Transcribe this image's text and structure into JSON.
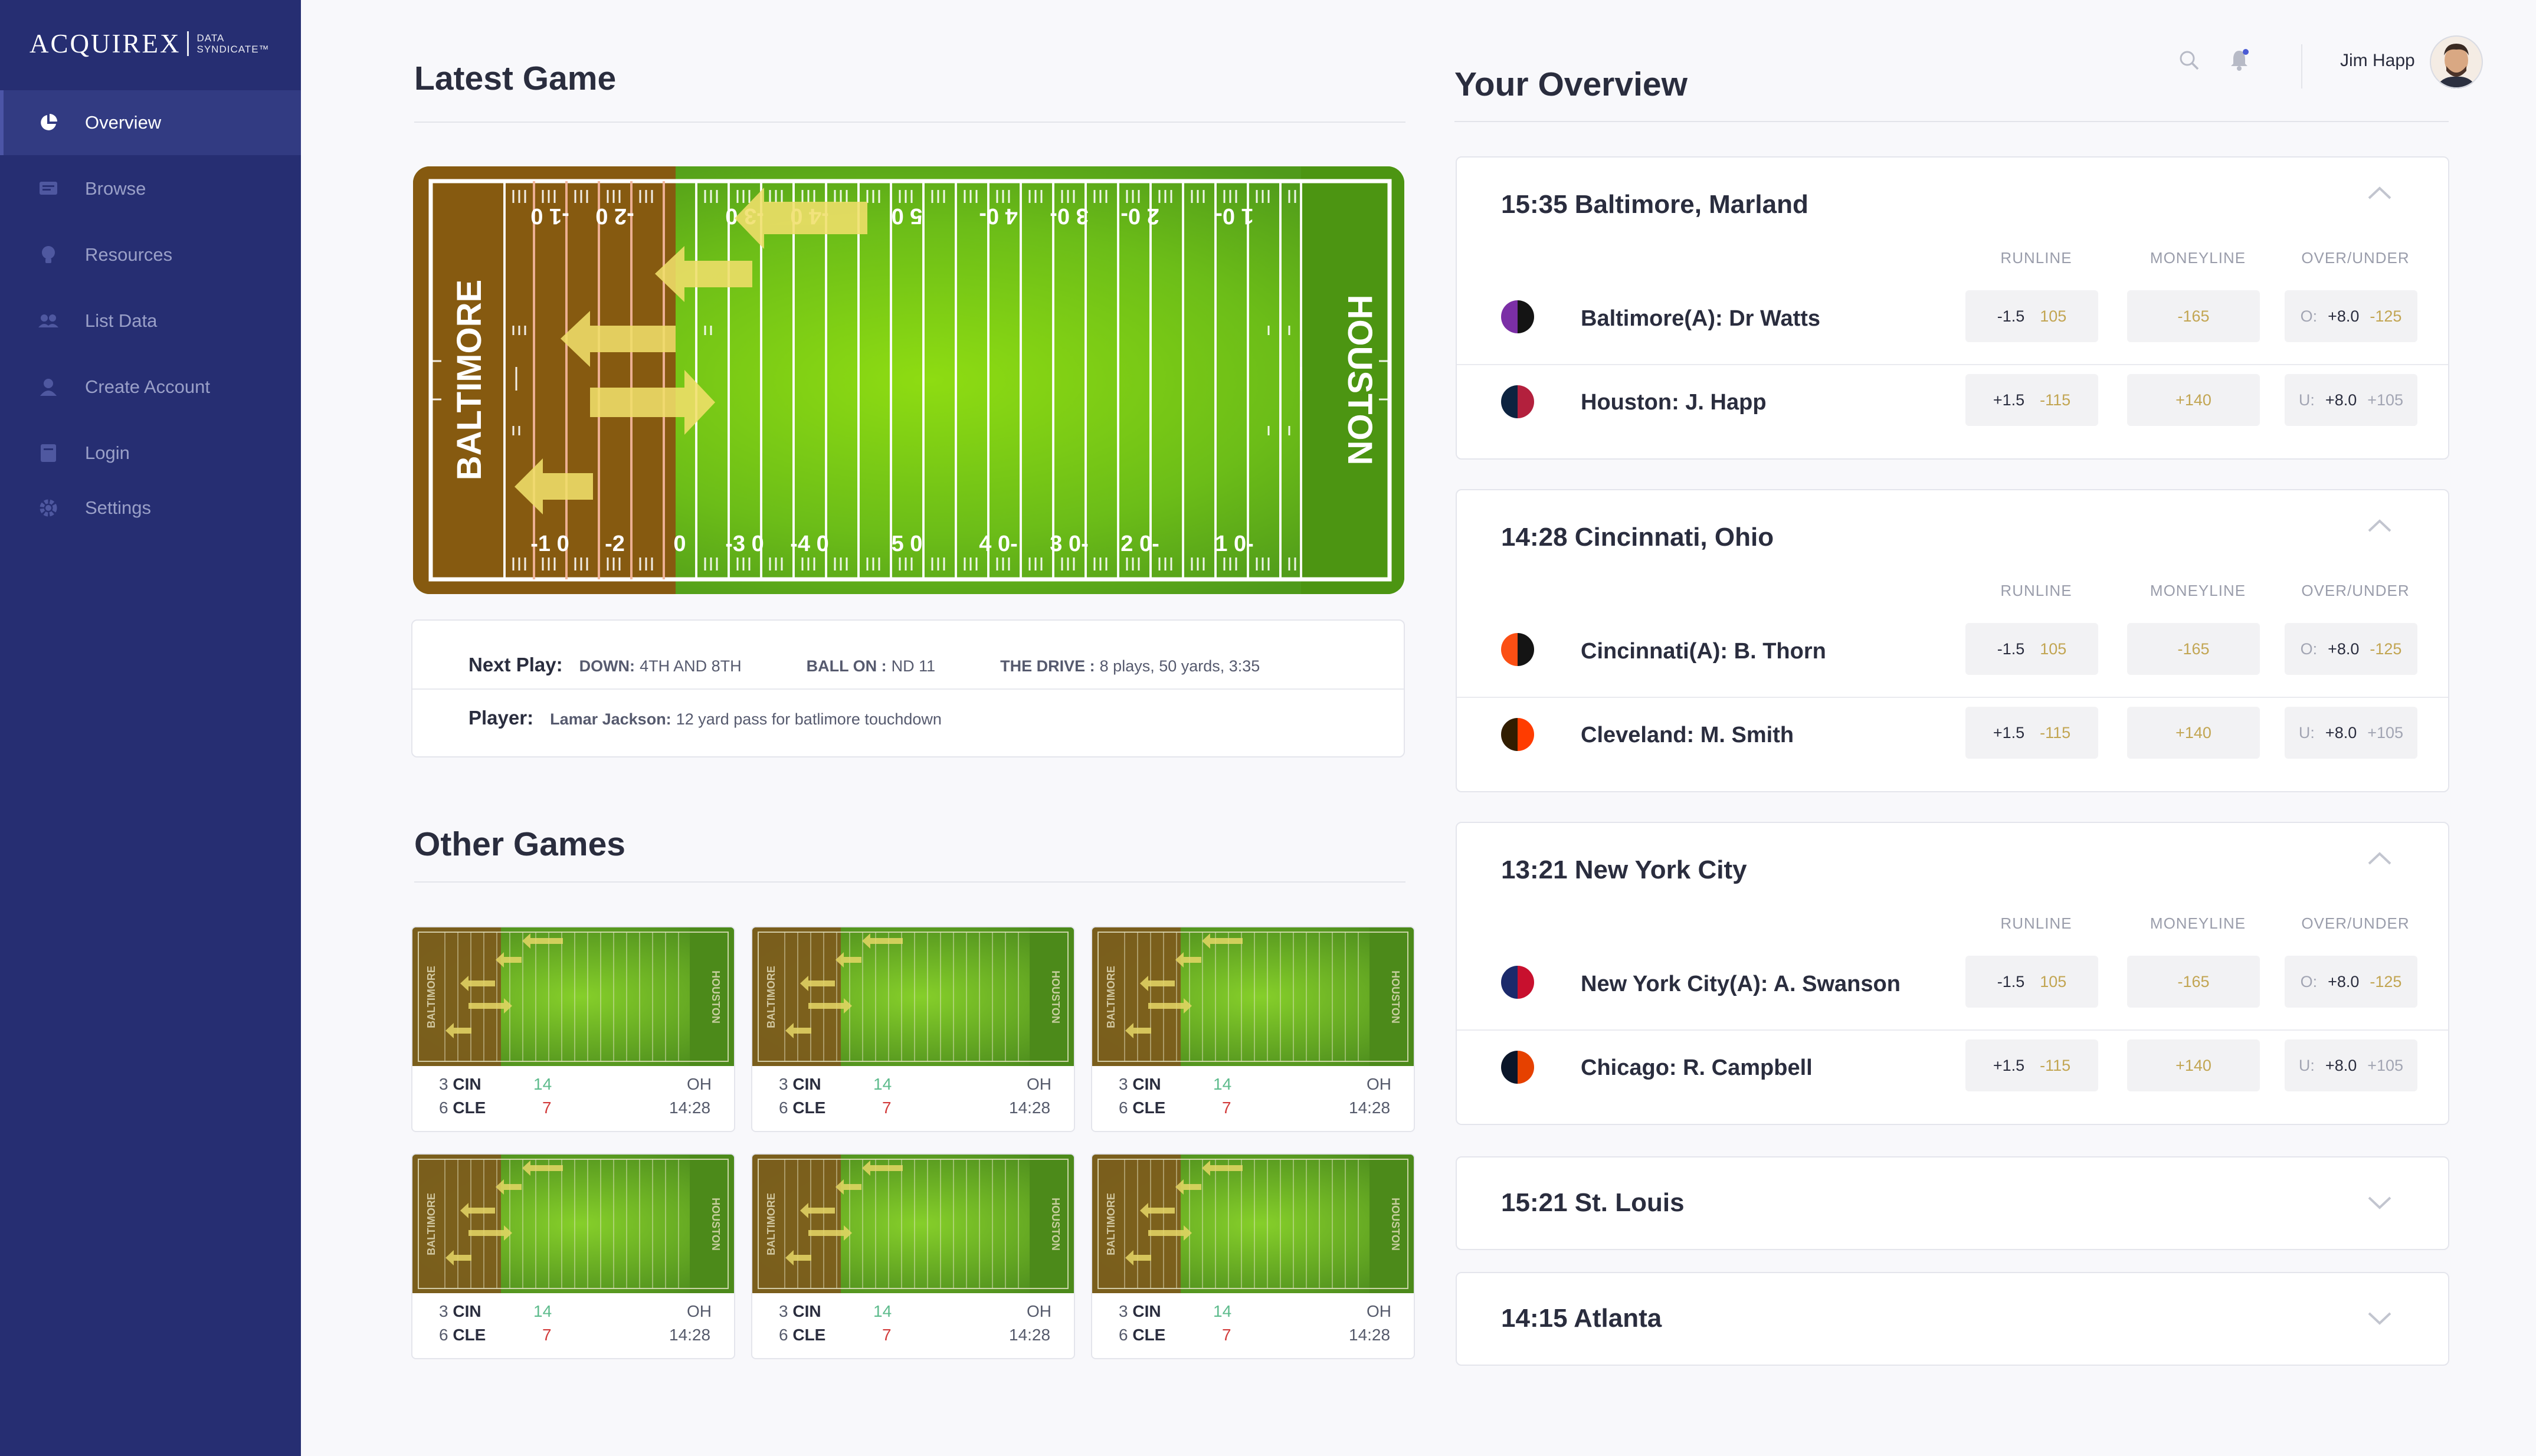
{
  "app": {
    "logo_main": "ACQUIREX",
    "logo_sub1": "DATA",
    "logo_sub2": "SYNDICATE™"
  },
  "sidebar": {
    "items": [
      {
        "label": "Overview",
        "icon": "pie-chart-icon",
        "active": true
      },
      {
        "label": "Browse",
        "icon": "browse-icon",
        "active": false
      },
      {
        "label": "Resources",
        "icon": "lightbulb-icon",
        "active": false
      },
      {
        "label": "List Data",
        "icon": "users-icon",
        "active": false
      },
      {
        "label": "Create Account",
        "icon": "user-icon",
        "active": false
      },
      {
        "label": "Login",
        "icon": "book-icon",
        "active": false
      },
      {
        "label": "Settings",
        "icon": "gear-icon",
        "active": false
      }
    ]
  },
  "header": {
    "user_name": "Jim Happ"
  },
  "latest_game": {
    "title": "Latest Game",
    "home_team": "BALTIMORE",
    "away_team": "HOUSTON",
    "next_play_label": "Next Play:",
    "down_label": "DOWN:",
    "down_value": "4TH AND 8TH",
    "ball_on_label": "BALL ON :",
    "ball_on_value": "ND 11",
    "drive_label": "THE DRIVE :",
    "drive_value": "8 plays, 50 yards, 3:35",
    "player_label": "Player:",
    "player_name": "Lamar Jackson:",
    "player_value": "12 yard pass for batlimore touchdown"
  },
  "other_games": {
    "title": "Other Games",
    "games": [
      {
        "home_team": "BALTIMORE",
        "away_team": "HOUSTON",
        "t1_rank": "3",
        "t1": "CIN",
        "t1_score": "14",
        "t2_rank": "6",
        "t2": "CLE",
        "t2_score": "7",
        "state": "OH",
        "time": "14:28"
      },
      {
        "home_team": "BALTIMORE",
        "away_team": "HOUSTON",
        "t1_rank": "3",
        "t1": "CIN",
        "t1_score": "14",
        "t2_rank": "6",
        "t2": "CLE",
        "t2_score": "7",
        "state": "OH",
        "time": "14:28"
      },
      {
        "home_team": "BALTIMORE",
        "away_team": "HOUSTON",
        "t1_rank": "3",
        "t1": "CIN",
        "t1_score": "14",
        "t2_rank": "6",
        "t2": "CLE",
        "t2_score": "7",
        "state": "OH",
        "time": "14:28"
      },
      {
        "home_team": "BALTIMORE",
        "away_team": "HOUSTON",
        "t1_rank": "3",
        "t1": "CIN",
        "t1_score": "14",
        "t2_rank": "6",
        "t2": "CLE",
        "t2_score": "7",
        "state": "OH",
        "time": "14:28"
      },
      {
        "home_team": "BALTIMORE",
        "away_team": "HOUSTON",
        "t1_rank": "3",
        "t1": "CIN",
        "t1_score": "14",
        "t2_rank": "6",
        "t2": "CLE",
        "t2_score": "7",
        "state": "OH",
        "time": "14:28"
      },
      {
        "home_team": "BALTIMORE",
        "away_team": "HOUSTON",
        "t1_rank": "3",
        "t1": "CIN",
        "t1_score": "14",
        "t2_rank": "6",
        "t2": "CLE",
        "t2_score": "7",
        "state": "OH",
        "time": "14:28"
      }
    ]
  },
  "overview": {
    "title": "Your Overview",
    "col_runline": "RUNLINE",
    "col_moneyline": "MONEYLINE",
    "col_overunder": "OVER/UNDER",
    "games": [
      {
        "title": "15:35 Baltimore, Marland",
        "expanded": true,
        "teams": [
          {
            "name": "Baltimore(A): Dr Watts",
            "colors": [
              "#7b2fa6",
              "#141414"
            ],
            "runline": "-1.5",
            "runline_odds": "105",
            "moneyline": "-165",
            "ou_prefix": "O:",
            "ou": "+8.0",
            "ou_odds": "-125"
          },
          {
            "name": "Houston: J. Happ",
            "colors": [
              "#0d2340",
              "#b3203d"
            ],
            "runline": "+1.5",
            "runline_odds": "-115",
            "moneyline": "+140",
            "ou_prefix": "U:",
            "ou": "+8.0",
            "ou_odds": "+105"
          }
        ]
      },
      {
        "title": "14:28 Cincinnati, Ohio",
        "expanded": true,
        "teams": [
          {
            "name": "Cincinnati(A): B. Thorn",
            "colors": [
              "#fb4f14",
              "#141414"
            ],
            "runline": "-1.5",
            "runline_odds": "105",
            "moneyline": "-165",
            "ou_prefix": "O:",
            "ou": "+8.0",
            "ou_odds": "-125"
          },
          {
            "name": "Cleveland: M. Smith",
            "colors": [
              "#311d00",
              "#ff3c00"
            ],
            "runline": "+1.5",
            "runline_odds": "-115",
            "moneyline": "+140",
            "ou_prefix": "U:",
            "ou": "+8.0",
            "ou_odds": "+105"
          }
        ]
      },
      {
        "title": "13:21 New York City",
        "expanded": true,
        "teams": [
          {
            "name": "New York City(A): A. Swanson",
            "colors": [
              "#1b2a6b",
              "#c8102e"
            ],
            "runline": "-1.5",
            "runline_odds": "105",
            "moneyline": "-165",
            "ou_prefix": "O:",
            "ou": "+8.0",
            "ou_odds": "-125"
          },
          {
            "name": "Chicago: R. Campbell",
            "colors": [
              "#0b162a",
              "#e64100"
            ],
            "runline": "+1.5",
            "runline_odds": "-115",
            "moneyline": "+140",
            "ou_prefix": "U:",
            "ou": "+8.0",
            "ou_odds": "+105"
          }
        ]
      },
      {
        "title": "15:21 St. Louis",
        "expanded": false
      },
      {
        "title": "14:15 Atlanta",
        "expanded": false
      }
    ]
  },
  "colors": {
    "sidebar_bg": "#262e72",
    "sidebar_active": "#323b82",
    "odds_gold": "#c2a552",
    "score_green": "#5dbb8c",
    "score_red": "#d23b3b",
    "field_green": "#5aa51a",
    "endzone_brown": "#8a5a0a"
  }
}
